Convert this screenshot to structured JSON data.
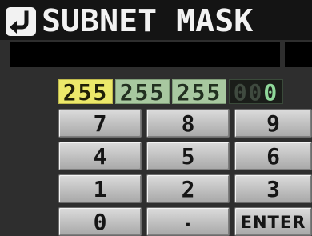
{
  "header": {
    "title": "SUBNET MASK",
    "back_icon": "return-arrow-icon"
  },
  "display": {
    "value": ""
  },
  "octets": [
    {
      "value": "255",
      "state": "selected",
      "color": "#ece86a"
    },
    {
      "value": "255",
      "state": "entered",
      "color": "#a8c8a0"
    },
    {
      "value": "255",
      "state": "entered",
      "color": "#a8c8a0"
    },
    {
      "dim_text": "00",
      "value": "0",
      "state": "pending",
      "color": "#8fd89a"
    }
  ],
  "keypad": {
    "keys": [
      "7",
      "8",
      "9",
      "4",
      "5",
      "6",
      "1",
      "2",
      "3",
      "0",
      ".",
      "ENTER"
    ]
  }
}
